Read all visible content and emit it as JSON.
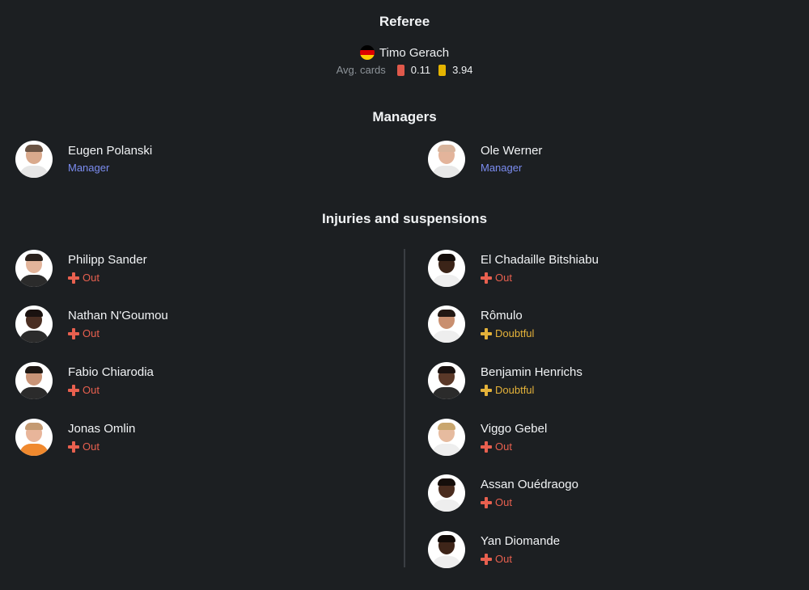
{
  "referee": {
    "title": "Referee",
    "name": "Timo Gerach",
    "flag_icon": "germany-flag-icon",
    "avg_label": "Avg. cards",
    "red_avg": "0.11",
    "yellow_avg": "3.94"
  },
  "managers": {
    "title": "Managers",
    "home": {
      "name": "Eugen Polanski",
      "role": "Manager"
    },
    "away": {
      "name": "Ole Werner",
      "role": "Manager"
    }
  },
  "injuries": {
    "title": "Injuries and suspensions",
    "home": [
      {
        "name": "Philipp Sander",
        "status": "Out"
      },
      {
        "name": "Nathan N'Goumou",
        "status": "Out"
      },
      {
        "name": "Fabio Chiarodia",
        "status": "Out"
      },
      {
        "name": "Jonas Omlin",
        "status": "Out"
      }
    ],
    "away": [
      {
        "name": "El Chadaille Bitshiabu",
        "status": "Out"
      },
      {
        "name": "Rômulo",
        "status": "Doubtful"
      },
      {
        "name": "Benjamin Henrichs",
        "status": "Doubtful"
      },
      {
        "name": "Viggo Gebel",
        "status": "Out"
      },
      {
        "name": "Assan Ouédraogo",
        "status": "Out"
      },
      {
        "name": "Yan Diomande",
        "status": "Out"
      }
    ]
  },
  "colors": {
    "background": "#1c1f22",
    "manager_role": "#7b8cf0",
    "out": "#e8604f",
    "doubtful": "#e4b23a",
    "red_card": "#e0594b",
    "yellow_card": "#e5b400"
  }
}
